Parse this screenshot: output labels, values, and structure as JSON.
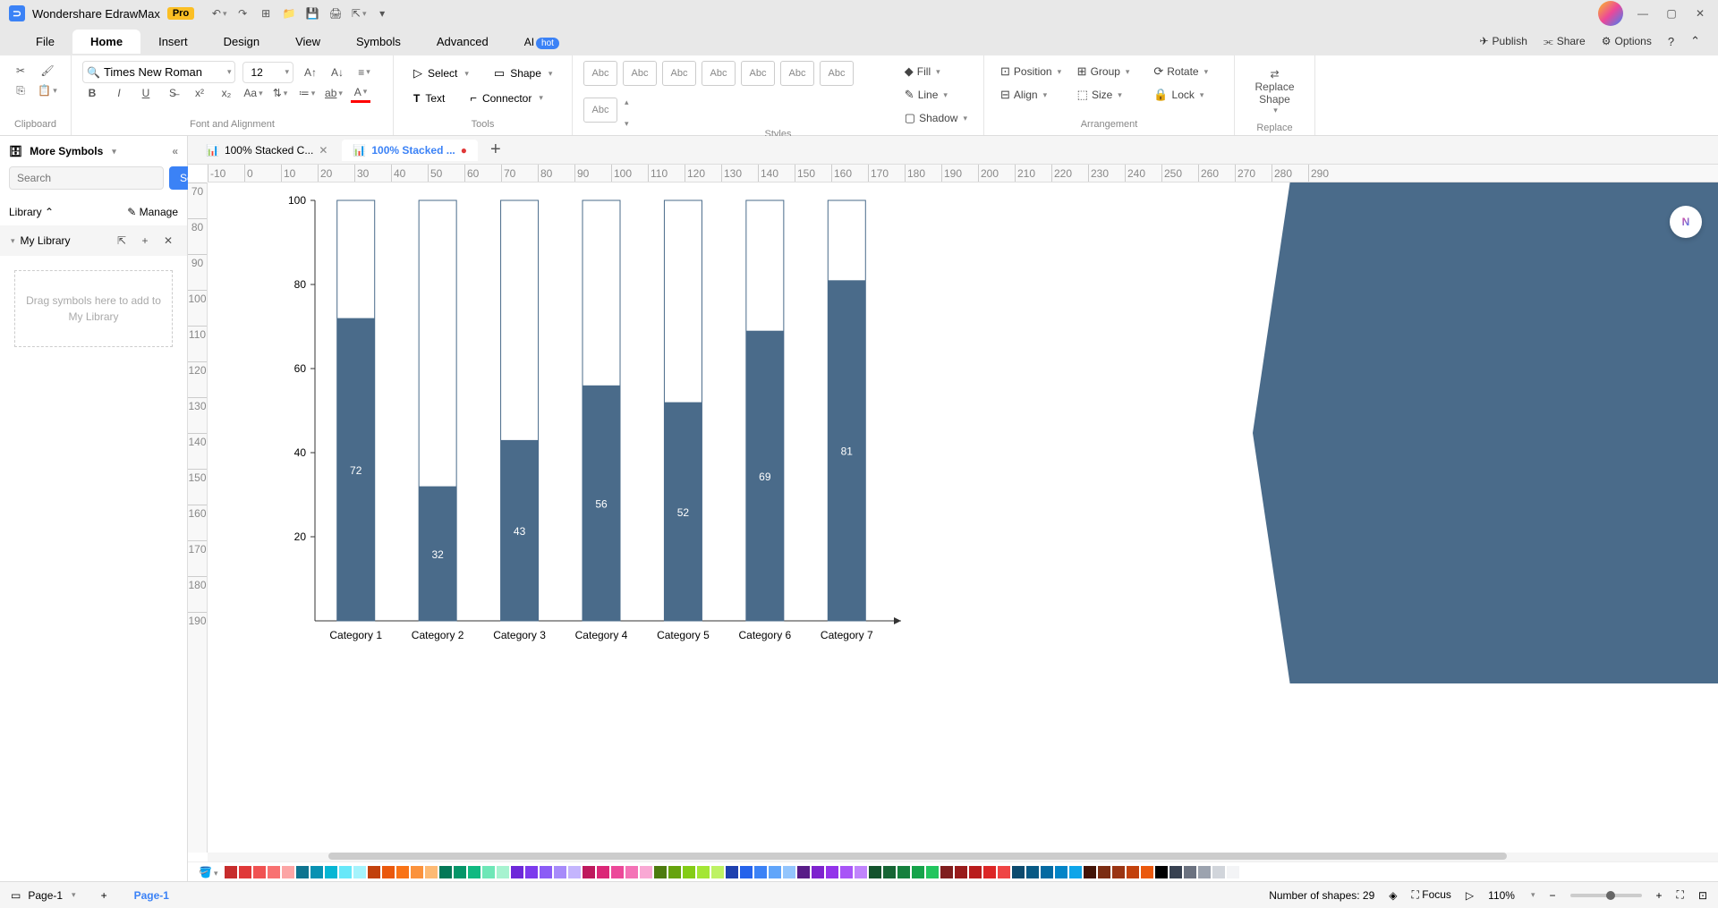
{
  "app": {
    "title": "Wondershare EdrawMax",
    "badge": "Pro"
  },
  "menu": {
    "items": [
      "File",
      "Home",
      "Insert",
      "Design",
      "View",
      "Symbols",
      "Advanced",
      "AI"
    ],
    "active": 1,
    "ai_badge": "hot"
  },
  "menubar_right": {
    "publish": "Publish",
    "share": "Share",
    "options": "Options"
  },
  "ribbon": {
    "clipboard": {
      "label": "Clipboard"
    },
    "font": {
      "family": "Times New Roman",
      "size": "12",
      "label": "Font and Alignment"
    },
    "tools": {
      "select": "Select",
      "shape": "Shape",
      "text": "Text",
      "connector": "Connector",
      "label": "Tools"
    },
    "styles": {
      "sample": "Abc",
      "fill": "Fill",
      "line": "Line",
      "shadow": "Shadow",
      "label": "Styles"
    },
    "arrange": {
      "position": "Position",
      "group": "Group",
      "rotate": "Rotate",
      "align": "Align",
      "size": "Size",
      "lock": "Lock",
      "label": "Arrangement"
    },
    "replace": {
      "l1": "Replace",
      "l2": "Shape",
      "label": "Replace"
    }
  },
  "sidebar": {
    "title": "More Symbols",
    "search_placeholder": "Search",
    "search_btn": "Search",
    "library": "Library",
    "manage": "Manage",
    "my_library": "My Library",
    "drop": "Drag symbols here to add to My Library"
  },
  "tabs": {
    "t1": "100% Stacked C...",
    "t2": "100% Stacked ..."
  },
  "ruler_h": [
    "-10",
    "0",
    "10",
    "20",
    "30",
    "40",
    "50",
    "60",
    "70",
    "80",
    "90",
    "100",
    "110",
    "120",
    "130",
    "140",
    "150",
    "160",
    "170",
    "180",
    "190",
    "200",
    "210",
    "220",
    "230",
    "240",
    "250",
    "260",
    "270",
    "280",
    "290"
  ],
  "ruler_v": [
    "70",
    "80",
    "90",
    "100",
    "110",
    "120",
    "130",
    "140",
    "150",
    "160",
    "170",
    "180",
    "190"
  ],
  "chart_data": {
    "type": "bar",
    "categories": [
      "Category 1",
      "Category 2",
      "Category 3",
      "Category 4",
      "Category 5",
      "Category 6",
      "Category 7"
    ],
    "values": [
      72,
      32,
      43,
      56,
      52,
      69,
      81
    ],
    "ylim": [
      0,
      100
    ],
    "yticks": [
      20,
      40,
      60,
      80,
      100
    ],
    "title": "",
    "xlabel": "",
    "ylabel": ""
  },
  "colors": [
    "#c72c2c",
    "#e03838",
    "#f05252",
    "#f87171",
    "#fca5a5",
    "#0e7490",
    "#0891b2",
    "#06b6d4",
    "#67e8f9",
    "#a5f3fc",
    "#c2410c",
    "#ea580c",
    "#f97316",
    "#fb923c",
    "#fdba74",
    "#047857",
    "#059669",
    "#10b981",
    "#6ee7b7",
    "#a7f3d0",
    "#6d28d9",
    "#7c3aed",
    "#8b5cf6",
    "#a78bfa",
    "#c4b5fd",
    "#be185d",
    "#db2777",
    "#ec4899",
    "#f472b6",
    "#f9a8d4",
    "#4d7c0f",
    "#65a30d",
    "#84cc16",
    "#a3e635",
    "#bef264",
    "#1e40af",
    "#2563eb",
    "#3b82f6",
    "#60a5fa",
    "#93c5fd",
    "#581c87",
    "#7e22ce",
    "#9333ea",
    "#a855f7",
    "#c084fc",
    "#14532d",
    "#166534",
    "#15803d",
    "#16a34a",
    "#22c55e",
    "#7f1d1d",
    "#991b1b",
    "#b91c1c",
    "#dc2626",
    "#ef4444",
    "#0c4a6e",
    "#075985",
    "#0369a1",
    "#0284c7",
    "#0ea5e9",
    "#431407",
    "#7c2d12",
    "#9a3412",
    "#c2410c",
    "#ea580c",
    "#000000",
    "#374151",
    "#6b7280",
    "#9ca3af",
    "#d1d5db",
    "#f3f4f6"
  ],
  "status": {
    "page_name": "Page-1",
    "page_tab": "Page-1",
    "shapes": "Number of shapes: 29",
    "focus": "Focus",
    "zoom": "110%"
  }
}
